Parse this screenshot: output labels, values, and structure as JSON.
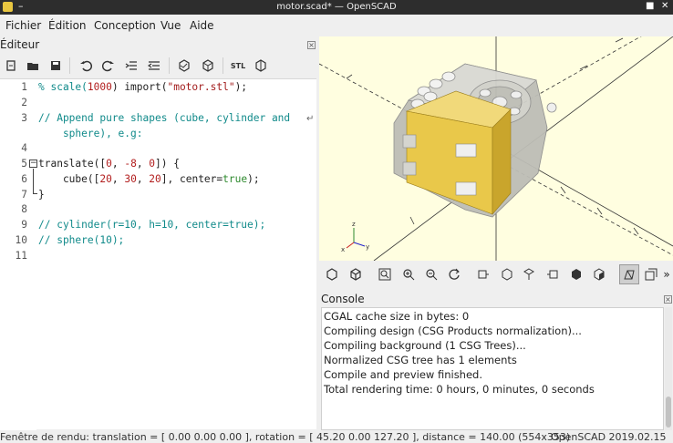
{
  "window": {
    "title": "motor.scad* — OpenSCAD"
  },
  "menu": {
    "items": [
      "Fichier",
      "Édition",
      "Conception",
      "Vue",
      "Aide"
    ]
  },
  "editor": {
    "title": "Éditeur",
    "line_numbers": [
      "1",
      "2",
      "3",
      "4",
      "5",
      "6",
      "7",
      "8",
      "9",
      "10",
      "11"
    ],
    "line1": {
      "a": "% scale(",
      "b": "1000",
      "c": ") import(",
      "d": "\"motor.stl\"",
      "e": ");"
    },
    "line3": "// Append pure shapes (cube, cylinder and",
    "line3b": "    sphere), e.g:",
    "line5": {
      "a": "translate([",
      "b": "0",
      "c": ", ",
      "d": "-8",
      "e": ", ",
      "f": "0",
      "g": "]) {"
    },
    "line6": {
      "a": "    cube([",
      "b": "20",
      "c": ", ",
      "d": "30",
      "e": ", ",
      "f": "20",
      "g": "], center=",
      "h": "true",
      "i": ");"
    },
    "line7": "}",
    "line9": "// cylinder(r=10, h=10, center=true);",
    "line10": "// sphere(10);"
  },
  "viewport": {
    "background": "#fffee0"
  },
  "console": {
    "title": "Console",
    "lines": [
      "CGAL cache size in bytes: 0",
      "Compiling design (CSG Products normalization)...",
      "Compiling background (1 CSG Trees)...",
      "Normalized CSG tree has 1 elements",
      "Compile and preview finished.",
      "Total rendering time: 0 hours, 0 minutes, 0 seconds"
    ]
  },
  "status": {
    "left": "Fenêtre de rendu: translation = [ 0.00 0.00 0.00 ], rotation = [ 45.20 0.00 127.20 ], distance = 140.00 (554x353)",
    "right": "OpenSCAD 2019.02.15"
  },
  "colors": {
    "comment": "#108a8a",
    "number": "#b21e1e",
    "keyword": "#2e8a2e",
    "object": "#e9c84a"
  },
  "icons": [
    "new-file-icon",
    "open-file-icon",
    "save-icon",
    "undo-icon",
    "redo-icon",
    "unindent-icon",
    "indent-icon",
    "preview-icon",
    "render-icon",
    "export-stl-icon",
    "send-to-print-icon"
  ]
}
